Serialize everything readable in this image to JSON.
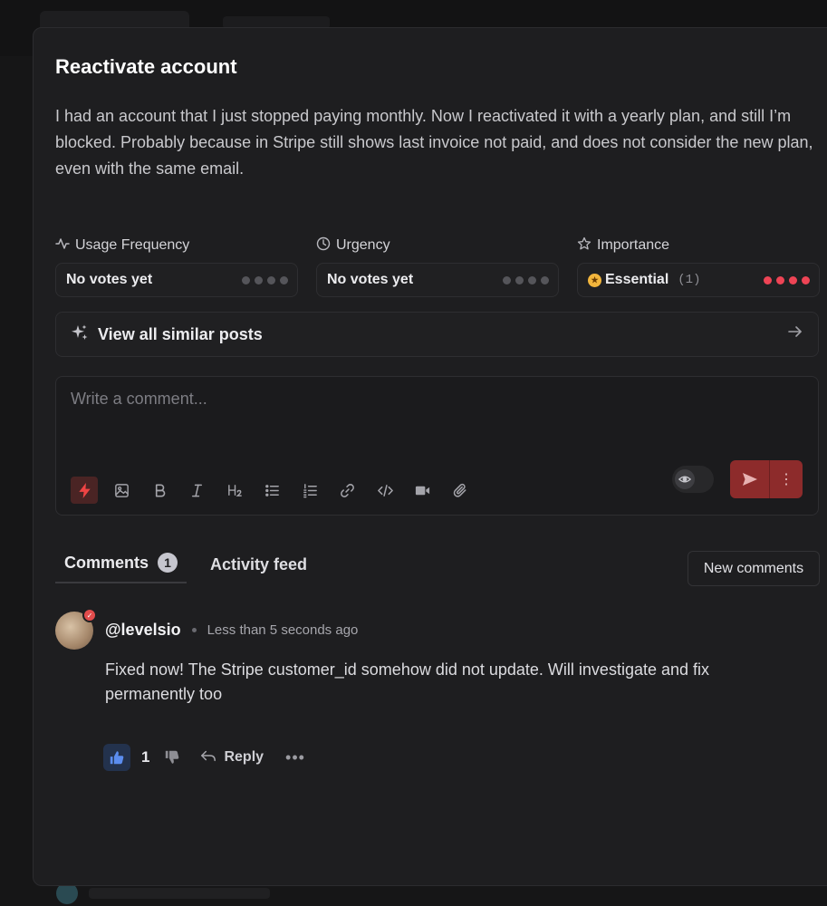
{
  "post": {
    "title": "Reactivate account",
    "description": "I had an account that I just stopped paying monthly. Now I reactivated it with a yearly plan, and still I’m blocked. Probably because in Stripe still shows last invoice not paid, and does not consider the new plan, even with the same email."
  },
  "metrics": [
    {
      "label": "Usage Frequency",
      "icon": "activity-icon",
      "value": "No votes yet",
      "count": "",
      "filled_dots": 0,
      "total_dots": 4
    },
    {
      "label": "Urgency",
      "icon": "clock-icon",
      "value": "No votes yet",
      "count": "",
      "filled_dots": 0,
      "total_dots": 4
    },
    {
      "label": "Importance",
      "icon": "star-icon",
      "value": "Essential",
      "emoji": "star-struck-emoji-icon",
      "count": "(1)",
      "filled_dots": 4,
      "total_dots": 4
    }
  ],
  "similar_posts": {
    "label": "View all similar posts"
  },
  "composer": {
    "placeholder": "Write a comment...",
    "toolbar": [
      "lightning-icon",
      "image-icon",
      "bold-icon",
      "italic-icon",
      "heading-icon",
      "bullet-list-icon",
      "numbered-list-icon",
      "link-icon",
      "code-icon",
      "video-icon",
      "attachment-icon"
    ]
  },
  "tabs": {
    "comments_label": "Comments",
    "comments_count": "1",
    "activity_label": "Activity feed",
    "new_comments_label": "New comments"
  },
  "comment": {
    "username": "@levelsio",
    "time": "Less than 5 seconds ago",
    "body": "Fixed now! The Stripe customer_id somehow did not update. Will investigate and fix permanently too",
    "likes": "1",
    "reply_label": "Reply"
  },
  "colors": {
    "accent_red": "#ef4444",
    "dot_red": "#ee4455",
    "like_blue": "#5b8def",
    "modal_bg": "#1e1e20"
  }
}
